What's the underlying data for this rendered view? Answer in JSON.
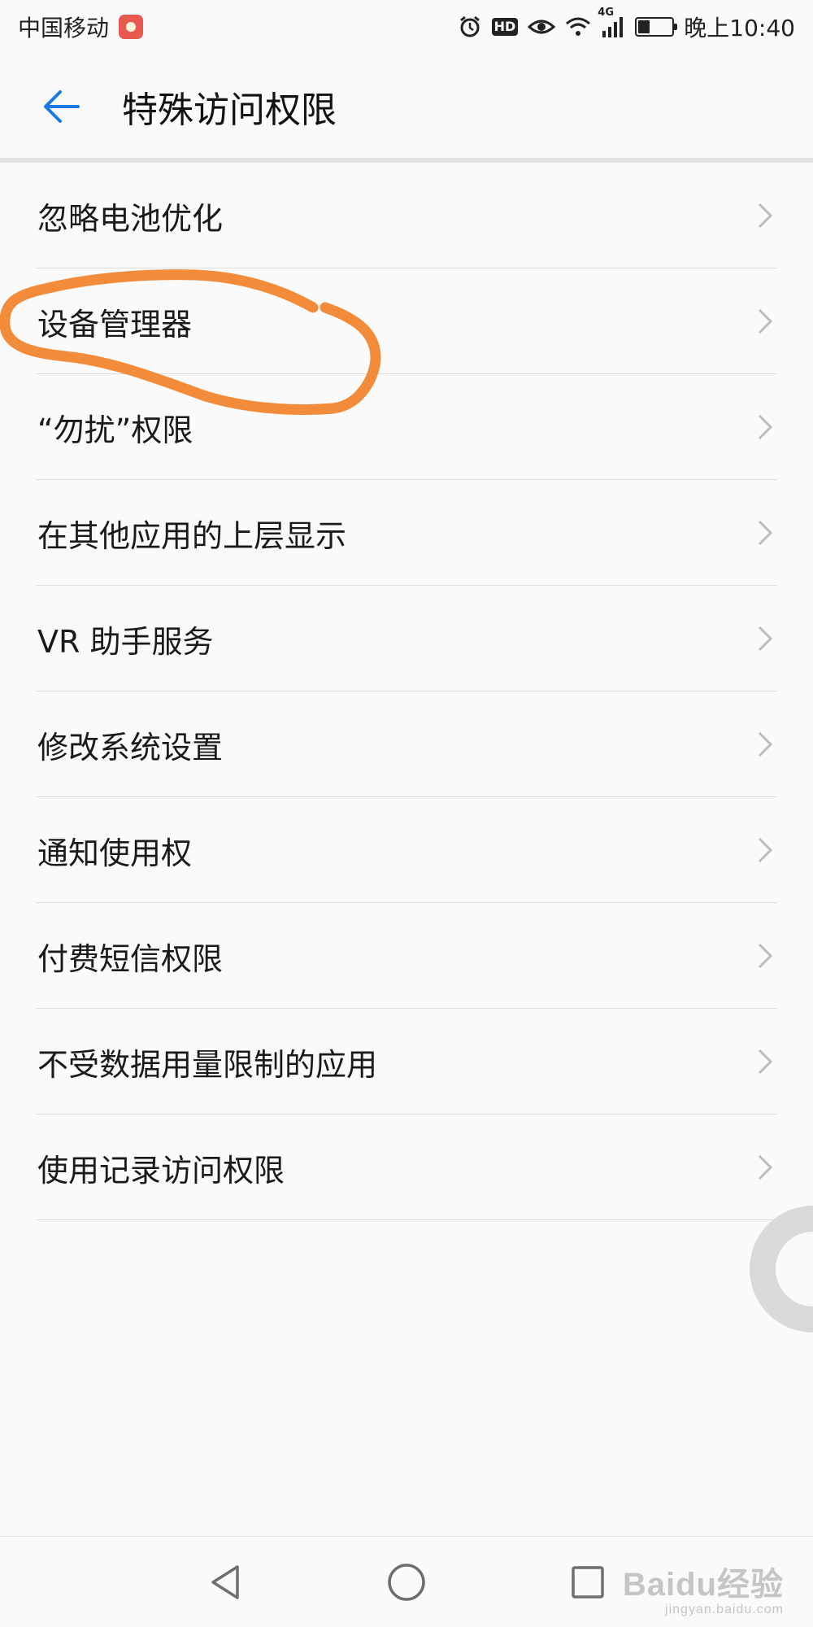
{
  "status_bar": {
    "carrier": "中国移动",
    "network_label": "4G",
    "time": "晚上10:40",
    "battery_level": 0.35,
    "icons": [
      "carrier-app-icon",
      "alarm-icon",
      "hd-icon",
      "eye-icon",
      "wifi-icon",
      "signal-icon",
      "battery-icon"
    ]
  },
  "header": {
    "title": "特殊访问权限",
    "back_icon": "back-arrow-icon",
    "accent_color": "#1a7ae5"
  },
  "settings": {
    "items": [
      {
        "label": "忽略电池优化"
      },
      {
        "label": "设备管理器"
      },
      {
        "label": "“勿扰”权限"
      },
      {
        "label": "在其他应用的上层显示"
      },
      {
        "label": "VR 助手服务"
      },
      {
        "label": "修改系统设置"
      },
      {
        "label": "通知使用权"
      },
      {
        "label": "付费短信权限"
      },
      {
        "label": "不受数据用量限制的应用"
      },
      {
        "label": "使用记录访问权限"
      }
    ],
    "chevron_icon": "chevron-right-icon"
  },
  "annotation": {
    "color": "#f28c3a",
    "target_item": "设备管理器"
  },
  "nav_bar": {
    "icons": [
      "back-triangle-icon",
      "home-circle-icon",
      "recents-square-icon"
    ]
  },
  "watermark": {
    "main": "Baidu经验",
    "sub": "jingyan.baidu.com"
  }
}
